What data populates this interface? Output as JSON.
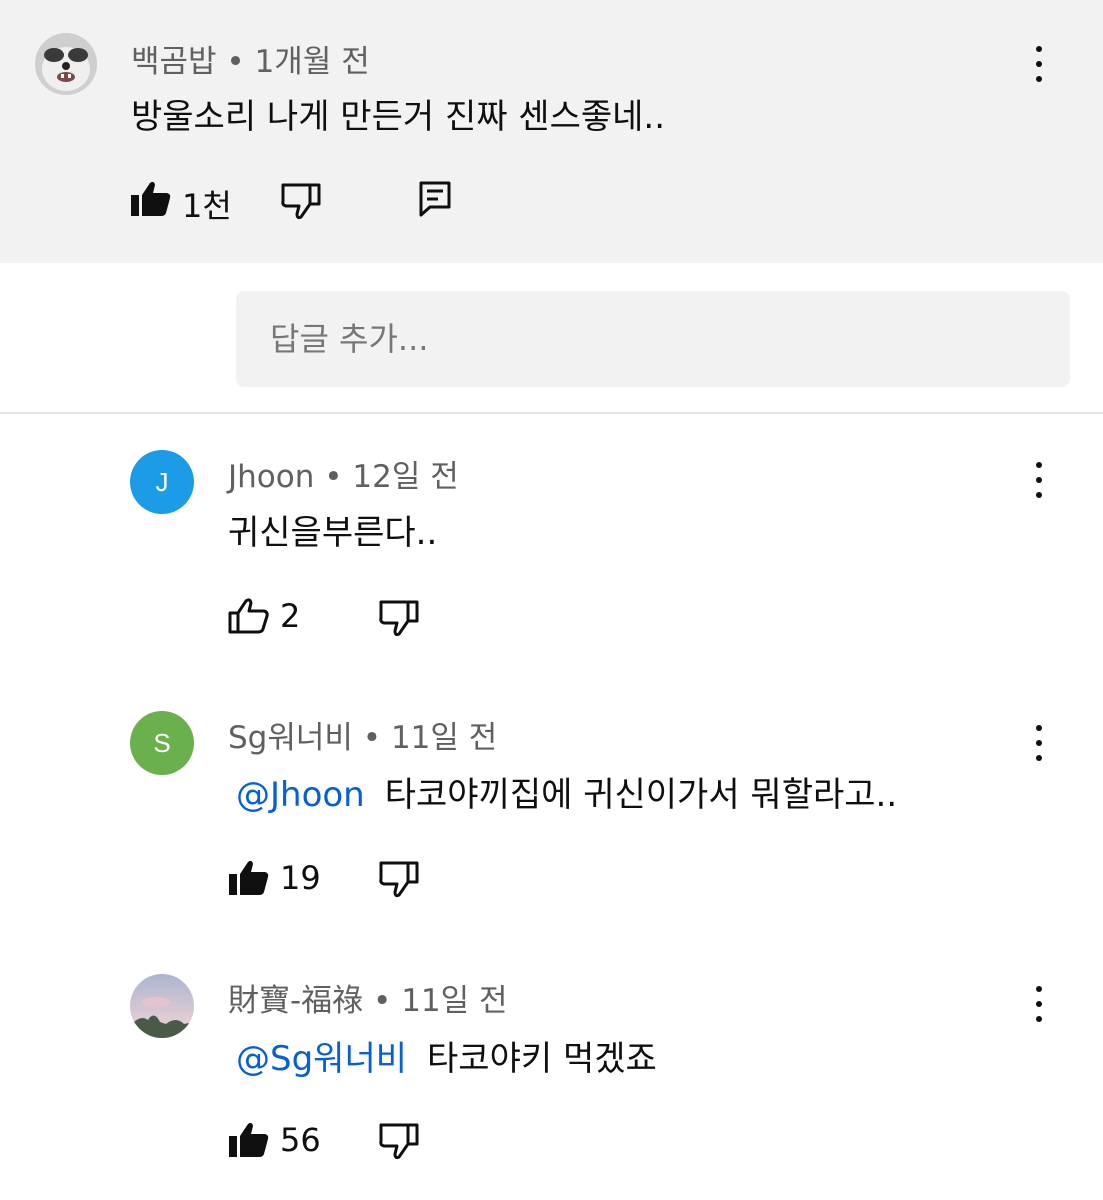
{
  "top_comment": {
    "author": "백곰밥",
    "time": "1개월 전",
    "text": "방울소리 나게 만든거 진짜 센스좋네..",
    "likes": "1천",
    "liked": true
  },
  "reply_input": {
    "placeholder": "답글 추가..."
  },
  "replies": [
    {
      "author": "Jhoon",
      "time": "12일 전",
      "avatar_letter": "J",
      "avatar_color": "#1c9be6",
      "mention": "",
      "text": "귀신을부른다..",
      "likes": "2",
      "liked": false
    },
    {
      "author": "Sg워너비",
      "time": "11일 전",
      "avatar_letter": "S",
      "avatar_color": "#6ab04c",
      "mention": "@Jhoon",
      "text": "타코야끼집에 귀신이가서 뭐할라고..",
      "likes": "19",
      "liked": true
    },
    {
      "author": "財寶-福祿",
      "time": "11일 전",
      "avatar_letter": "",
      "avatar_color": "#b9c3d6",
      "mention": "@Sg워너비",
      "text": "타코야키 먹겠죠",
      "likes": "56",
      "liked": true
    }
  ],
  "separator": "•",
  "icons": {
    "like": "thumbs-up-icon",
    "dislike": "thumbs-down-icon",
    "reply": "reply-icon",
    "menu": "more-vert-icon"
  }
}
